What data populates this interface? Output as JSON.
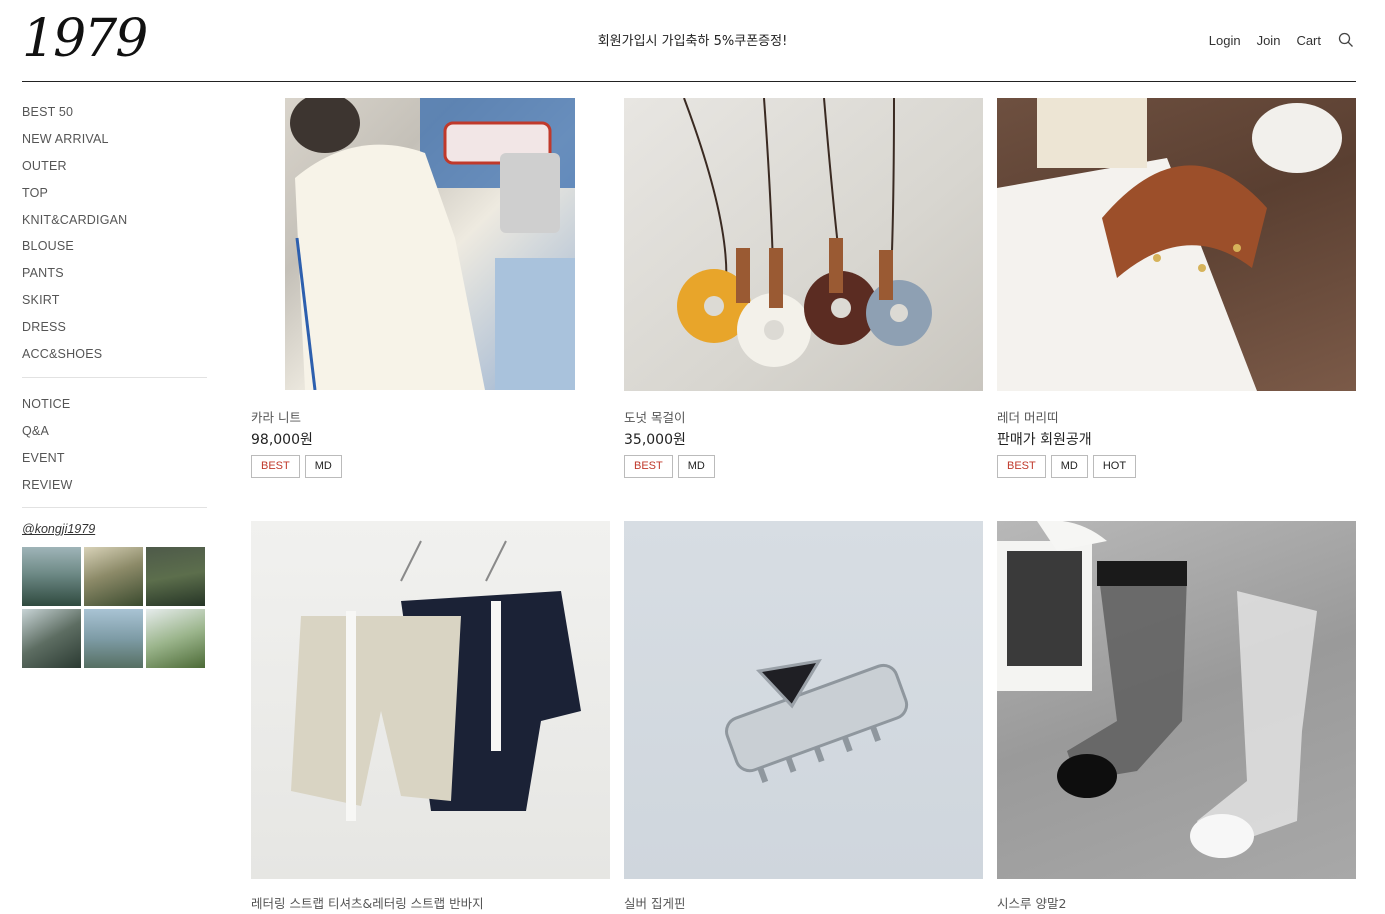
{
  "header": {
    "logo": "1979",
    "banner": "회원가입시 가입축하 5%쿠폰증정!",
    "nav": {
      "login": "Login",
      "join": "Join",
      "cart": "Cart"
    }
  },
  "sidebar": {
    "categories": [
      "BEST 50",
      "NEW ARRIVAL",
      "OUTER",
      "TOP",
      "KNIT&CARDIGAN",
      "BLOUSE",
      "PANTS",
      "SKIRT",
      "DRESS",
      "ACC&SHOES"
    ],
    "board": [
      "NOTICE",
      "Q&A",
      "EVENT",
      "REVIEW"
    ],
    "instagram_handle": "@kongji1979"
  },
  "products": [
    {
      "name": "카라 니트",
      "price": "98,000원",
      "tags": [
        "BEST",
        "MD"
      ]
    },
    {
      "name": "도넛 목걸이",
      "price": "35,000원",
      "tags": [
        "BEST",
        "MD"
      ]
    },
    {
      "name": "레더 머리띠",
      "price": "판매가 회원공개",
      "tags": [
        "BEST",
        "MD",
        "HOT"
      ]
    },
    {
      "name": "레터링 스트랩 티셔츠&레터링 스트랩 반바지",
      "price": "",
      "tags": []
    },
    {
      "name": "실버 집게핀",
      "price": "",
      "tags": []
    },
    {
      "name": "시스루 양말2",
      "price": "",
      "tags": []
    }
  ],
  "colors": {
    "best_tag": "#c0392b",
    "rule": "#222222"
  }
}
